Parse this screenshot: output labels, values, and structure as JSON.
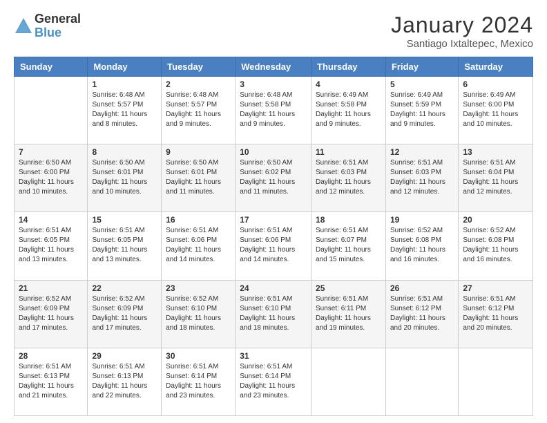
{
  "header": {
    "logo_line1": "General",
    "logo_line2": "Blue",
    "title": "January 2024",
    "subtitle": "Santiago Ixtaltepec, Mexico"
  },
  "weekdays": [
    "Sunday",
    "Monday",
    "Tuesday",
    "Wednesday",
    "Thursday",
    "Friday",
    "Saturday"
  ],
  "weeks": [
    [
      {
        "day": "",
        "sunrise": "",
        "sunset": "",
        "daylight": ""
      },
      {
        "day": "1",
        "sunrise": "6:48 AM",
        "sunset": "5:57 PM",
        "daylight": "11 hours and 8 minutes."
      },
      {
        "day": "2",
        "sunrise": "6:48 AM",
        "sunset": "5:57 PM",
        "daylight": "11 hours and 9 minutes."
      },
      {
        "day": "3",
        "sunrise": "6:48 AM",
        "sunset": "5:58 PM",
        "daylight": "11 hours and 9 minutes."
      },
      {
        "day": "4",
        "sunrise": "6:49 AM",
        "sunset": "5:58 PM",
        "daylight": "11 hours and 9 minutes."
      },
      {
        "day": "5",
        "sunrise": "6:49 AM",
        "sunset": "5:59 PM",
        "daylight": "11 hours and 9 minutes."
      },
      {
        "day": "6",
        "sunrise": "6:49 AM",
        "sunset": "6:00 PM",
        "daylight": "11 hours and 10 minutes."
      }
    ],
    [
      {
        "day": "7",
        "sunrise": "6:50 AM",
        "sunset": "6:00 PM",
        "daylight": "11 hours and 10 minutes."
      },
      {
        "day": "8",
        "sunrise": "6:50 AM",
        "sunset": "6:01 PM",
        "daylight": "11 hours and 10 minutes."
      },
      {
        "day": "9",
        "sunrise": "6:50 AM",
        "sunset": "6:01 PM",
        "daylight": "11 hours and 11 minutes."
      },
      {
        "day": "10",
        "sunrise": "6:50 AM",
        "sunset": "6:02 PM",
        "daylight": "11 hours and 11 minutes."
      },
      {
        "day": "11",
        "sunrise": "6:51 AM",
        "sunset": "6:03 PM",
        "daylight": "11 hours and 12 minutes."
      },
      {
        "day": "12",
        "sunrise": "6:51 AM",
        "sunset": "6:03 PM",
        "daylight": "11 hours and 12 minutes."
      },
      {
        "day": "13",
        "sunrise": "6:51 AM",
        "sunset": "6:04 PM",
        "daylight": "11 hours and 12 minutes."
      }
    ],
    [
      {
        "day": "14",
        "sunrise": "6:51 AM",
        "sunset": "6:05 PM",
        "daylight": "11 hours and 13 minutes."
      },
      {
        "day": "15",
        "sunrise": "6:51 AM",
        "sunset": "6:05 PM",
        "daylight": "11 hours and 13 minutes."
      },
      {
        "day": "16",
        "sunrise": "6:51 AM",
        "sunset": "6:06 PM",
        "daylight": "11 hours and 14 minutes."
      },
      {
        "day": "17",
        "sunrise": "6:51 AM",
        "sunset": "6:06 PM",
        "daylight": "11 hours and 14 minutes."
      },
      {
        "day": "18",
        "sunrise": "6:51 AM",
        "sunset": "6:07 PM",
        "daylight": "11 hours and 15 minutes."
      },
      {
        "day": "19",
        "sunrise": "6:52 AM",
        "sunset": "6:08 PM",
        "daylight": "11 hours and 16 minutes."
      },
      {
        "day": "20",
        "sunrise": "6:52 AM",
        "sunset": "6:08 PM",
        "daylight": "11 hours and 16 minutes."
      }
    ],
    [
      {
        "day": "21",
        "sunrise": "6:52 AM",
        "sunset": "6:09 PM",
        "daylight": "11 hours and 17 minutes."
      },
      {
        "day": "22",
        "sunrise": "6:52 AM",
        "sunset": "6:09 PM",
        "daylight": "11 hours and 17 minutes."
      },
      {
        "day": "23",
        "sunrise": "6:52 AM",
        "sunset": "6:10 PM",
        "daylight": "11 hours and 18 minutes."
      },
      {
        "day": "24",
        "sunrise": "6:51 AM",
        "sunset": "6:10 PM",
        "daylight": "11 hours and 18 minutes."
      },
      {
        "day": "25",
        "sunrise": "6:51 AM",
        "sunset": "6:11 PM",
        "daylight": "11 hours and 19 minutes."
      },
      {
        "day": "26",
        "sunrise": "6:51 AM",
        "sunset": "6:12 PM",
        "daylight": "11 hours and 20 minutes."
      },
      {
        "day": "27",
        "sunrise": "6:51 AM",
        "sunset": "6:12 PM",
        "daylight": "11 hours and 20 minutes."
      }
    ],
    [
      {
        "day": "28",
        "sunrise": "6:51 AM",
        "sunset": "6:13 PM",
        "daylight": "11 hours and 21 minutes."
      },
      {
        "day": "29",
        "sunrise": "6:51 AM",
        "sunset": "6:13 PM",
        "daylight": "11 hours and 22 minutes."
      },
      {
        "day": "30",
        "sunrise": "6:51 AM",
        "sunset": "6:14 PM",
        "daylight": "11 hours and 23 minutes."
      },
      {
        "day": "31",
        "sunrise": "6:51 AM",
        "sunset": "6:14 PM",
        "daylight": "11 hours and 23 minutes."
      },
      {
        "day": "",
        "sunrise": "",
        "sunset": "",
        "daylight": ""
      },
      {
        "day": "",
        "sunrise": "",
        "sunset": "",
        "daylight": ""
      },
      {
        "day": "",
        "sunrise": "",
        "sunset": "",
        "daylight": ""
      }
    ]
  ],
  "labels": {
    "sunrise": "Sunrise:",
    "sunset": "Sunset:",
    "daylight": "Daylight:"
  }
}
